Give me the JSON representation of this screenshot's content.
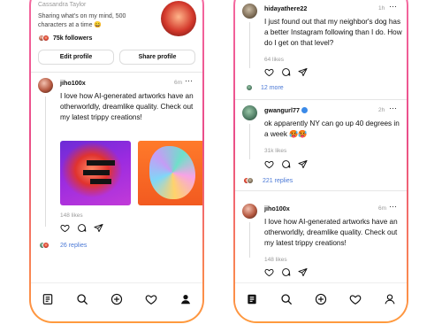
{
  "colors": {
    "phone_frame_top": "#f56aa0",
    "phone_frame_bottom": "#ff9a3d",
    "link": "#4a78d6",
    "verified": "#3b8ae8"
  },
  "left": {
    "profile": {
      "name": "Cassandra Taylor",
      "bio": "Sharing what's on my mind, 500 characters at a time 😄",
      "followers": "75k followers",
      "edit_button": "Edit profile",
      "share_button": "Share profile"
    },
    "post": {
      "handle": "jiho100x",
      "time": "6m",
      "more": "···",
      "text": "I love how AI-generated artworks have an otherworldly, dreamlike quality. Check out my latest trippy creations!",
      "likes": "148 likes",
      "replies": "26 replies"
    },
    "tabbar": [
      "home-icon",
      "search-icon",
      "compose-icon",
      "heart-icon",
      "profile-icon"
    ]
  },
  "right": {
    "posts": [
      {
        "handle": "hidayathere22",
        "time": "1h",
        "more": "···",
        "text": "I just found out that my neighbor's dog has a better Instagram following than I do. How do I get on that level?",
        "likes": "64 likes",
        "replies": "12 more"
      },
      {
        "handle": "gwangurl77",
        "time": "2h",
        "more": "···",
        "text": "ok apparently NY can go up 40 degrees in a week 🥵🥵",
        "likes": "31k likes",
        "replies": "221 replies"
      },
      {
        "handle": "jiho100x",
        "time": "6m",
        "more": "···",
        "text": "I love how AI-generated artworks have an otherworldly, dreamlike quality. Check out my latest trippy creations!",
        "likes": "148 likes"
      }
    ],
    "tabbar": [
      "feed-icon",
      "search-icon",
      "compose-icon",
      "heart-icon",
      "profile-icon"
    ]
  }
}
